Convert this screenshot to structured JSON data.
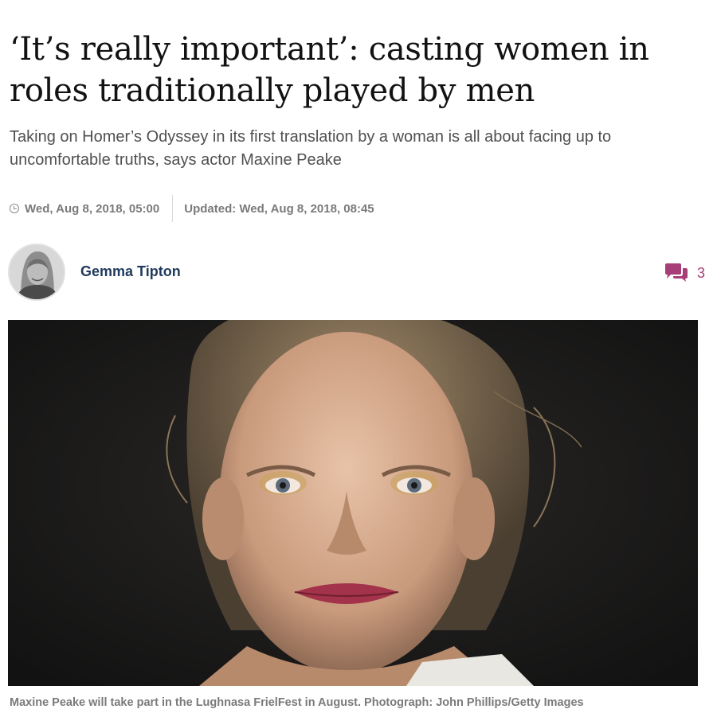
{
  "article": {
    "headline": "‘It’s really important’: casting women in roles traditionally played by men",
    "standfirst": "Taking on Homer’s Odyssey in its first translation by a woman is all about facing up to uncomfortable truths, says actor Maxine Peake",
    "published": "Wed, Aug 8, 2018, 05:00",
    "updated": "Updated: Wed, Aug 8, 2018, 08:45",
    "author": {
      "name": "Gemma Tipton"
    },
    "comments": {
      "count": "3",
      "icon": "speech-bubbles-icon"
    },
    "image": {
      "caption": "Maxine Peake will take part in the Lughnasa FrielFest in August. Photograph: John Phillips/Getty Images"
    }
  },
  "colors": {
    "headline": "#121212",
    "standfirst": "#505050",
    "meta": "#7a7a7a",
    "author": "#1f3a5c",
    "comments_accent": "#a63e78",
    "photo_background": "#1b1b1b"
  }
}
